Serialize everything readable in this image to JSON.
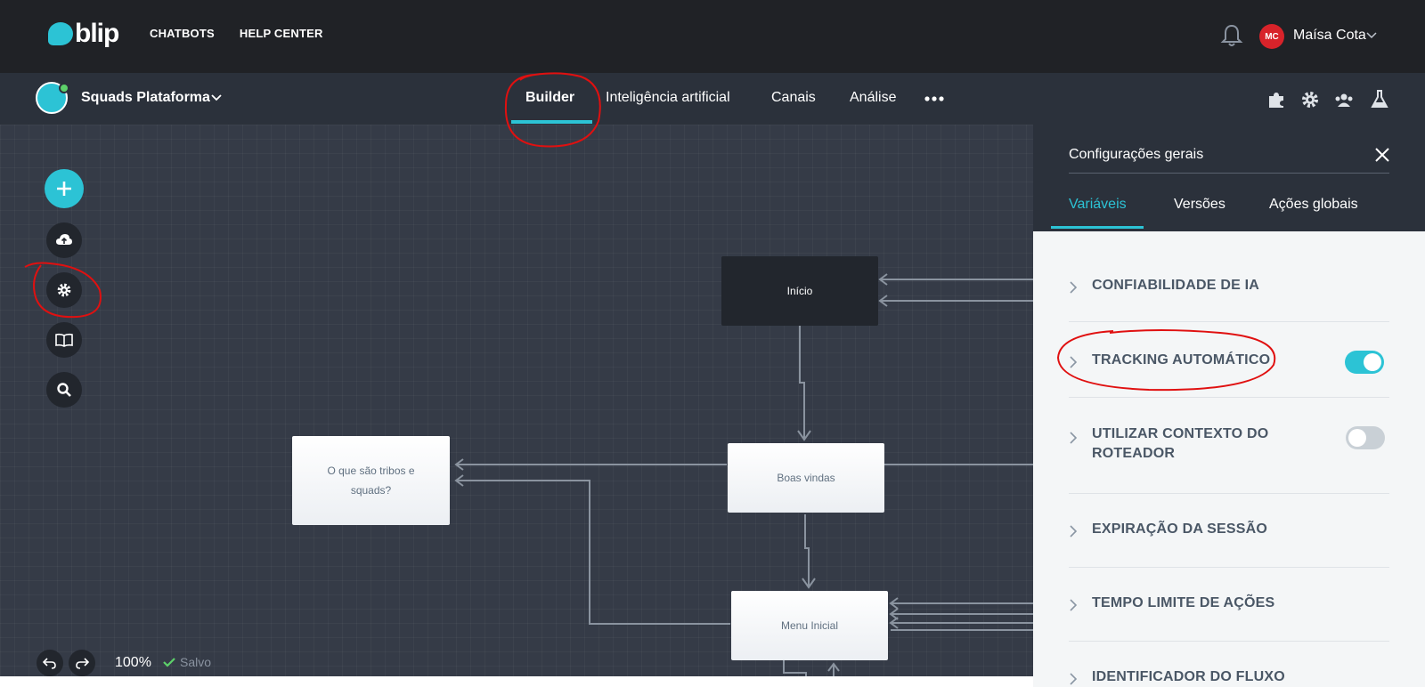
{
  "topbar": {
    "logo_text": "blip",
    "nav": [
      "CHATBOTS",
      "HELP CENTER"
    ],
    "user_initials": "MC",
    "user_name": "Maísa Cota"
  },
  "bot": {
    "name": "Squads Plataforma"
  },
  "tabs": {
    "builder": "Builder",
    "ai": "Inteligência artificial",
    "channels": "Canais",
    "analysis": "Análise"
  },
  "canvas": {
    "nodes": {
      "start": "Início",
      "welcome": "Boas vindas",
      "tribes": "O que são tribos e squads?",
      "menu": "Menu Inicial"
    },
    "zoom": "100%",
    "saved": "Salvo"
  },
  "panel": {
    "title": "Configurações gerais",
    "tabs": [
      "Variáveis",
      "Versões",
      "Ações globais"
    ],
    "settings": [
      {
        "label": "CONFIABILIDADE DE IA"
      },
      {
        "label": "TRACKING AUTOMÁTICO",
        "toggle": "on"
      },
      {
        "label": "UTILIZAR CONTEXTO DO ROTEADOR",
        "toggle": "off"
      },
      {
        "label": "EXPIRAÇÃO DA SESSÃO"
      },
      {
        "label": "TEMPO LIMITE DE AÇÕES"
      },
      {
        "label": "IDENTIFICADOR DO FLUXO"
      }
    ]
  },
  "colors": {
    "accent": "#2cc3d5",
    "topbar": "#202226",
    "subbar": "#2b313b",
    "canvas": "#353b47",
    "annotation": "#e01010"
  }
}
